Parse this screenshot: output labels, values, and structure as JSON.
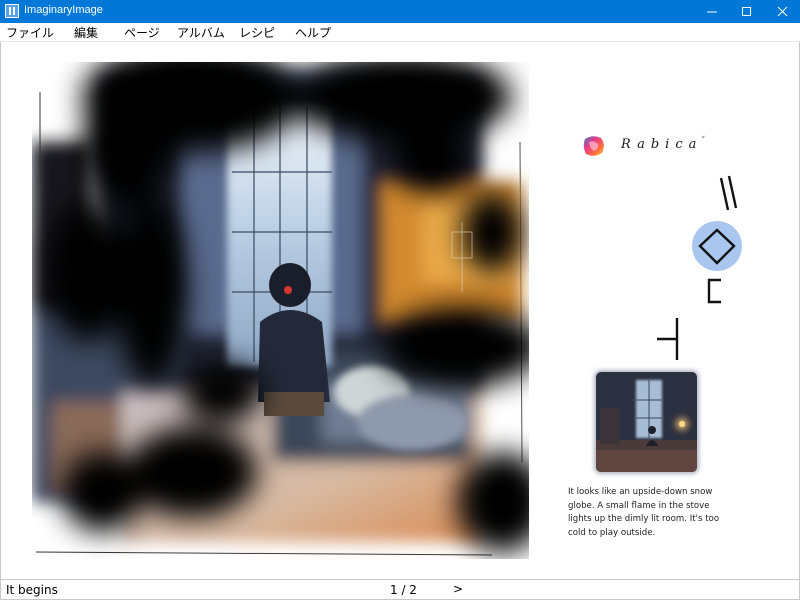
{
  "window": {
    "title": "ImaginaryImage",
    "controls": [
      "minimize",
      "maximize",
      "close"
    ]
  },
  "menu": [
    {
      "label": "ファイル"
    },
    {
      "label": "編集"
    },
    {
      "label": "ページ"
    },
    {
      "label": "アルバム"
    },
    {
      "label": "レシピ"
    },
    {
      "label": "ヘルプ"
    }
  ],
  "author": {
    "name": "Rabica",
    "chevron": "˅"
  },
  "caption": "It looks like an upside-down snow globe. A small flame in the stove lights up the dimly lit room. It's too cold to play outside.",
  "status": {
    "text": "It begins",
    "page": "1 / 2",
    "next": ">"
  },
  "colors": {
    "titlebar": "#0078d7",
    "accent_circle": "#a9c6ef"
  }
}
